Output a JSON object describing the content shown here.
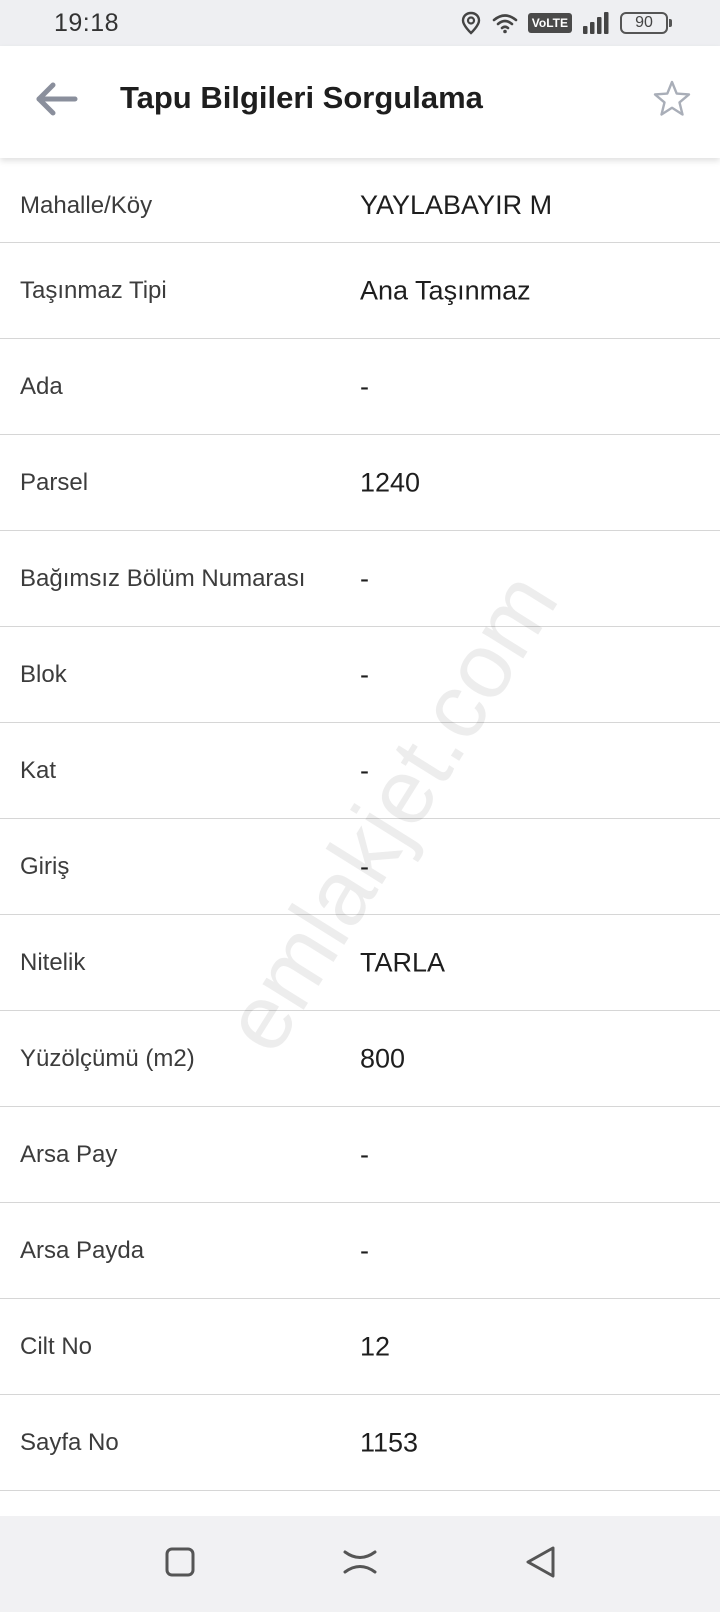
{
  "status_bar": {
    "time": "19:18",
    "network": "VoLTE",
    "battery": "90",
    "icons": [
      "location-icon",
      "wifi-icon",
      "volte-icon",
      "signal-icon",
      "battery-icon"
    ]
  },
  "app_bar": {
    "title": "Tapu Bilgileri Sorgulama",
    "back_icon": "arrow-left-icon",
    "favorite_icon": "star-outline-icon"
  },
  "rows": [
    {
      "label": "Mahalle/Köy",
      "value": "YAYLABAYIR M"
    },
    {
      "label": "Taşınmaz Tipi",
      "value": "Ana Taşınmaz"
    },
    {
      "label": "Ada",
      "value": "-"
    },
    {
      "label": "Parsel",
      "value": "1240"
    },
    {
      "label": "Bağımsız Bölüm Numarası",
      "value": "-"
    },
    {
      "label": "Blok",
      "value": "-"
    },
    {
      "label": "Kat",
      "value": "-"
    },
    {
      "label": "Giriş",
      "value": "-"
    },
    {
      "label": "Nitelik",
      "value": "TARLA"
    },
    {
      "label": "Yüzölçümü (m2)",
      "value": "800"
    },
    {
      "label": "Arsa Pay",
      "value": "-"
    },
    {
      "label": "Arsa Payda",
      "value": "-"
    },
    {
      "label": "Cilt No",
      "value": "12"
    },
    {
      "label": "Sayfa No",
      "value": "1153"
    }
  ],
  "watermark": "emlakjet.com",
  "nav_bar": {
    "icons": [
      "recents-square-icon",
      "home-icon",
      "back-triangle-icon"
    ]
  },
  "colors": {
    "status_bar_bg": "#eeeff2",
    "nav_bar_bg": "#f1f1f3",
    "divider": "#d6d6d6",
    "back_arrow": "#8a8f9c",
    "star_outline": "#a9aeb8"
  }
}
